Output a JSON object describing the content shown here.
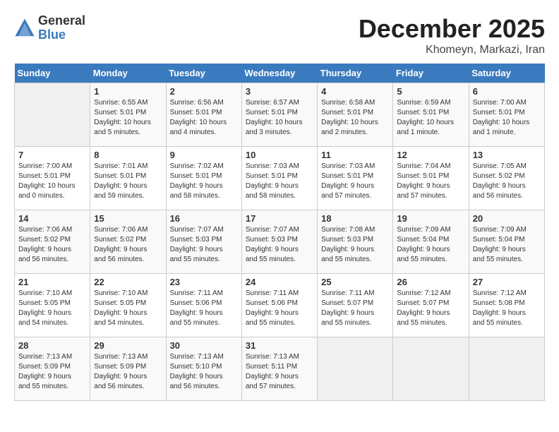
{
  "logo": {
    "general": "General",
    "blue": "Blue"
  },
  "title": "December 2025",
  "subtitle": "Khomeyn, Markazi, Iran",
  "weekdays": [
    "Sunday",
    "Monday",
    "Tuesday",
    "Wednesday",
    "Thursday",
    "Friday",
    "Saturday"
  ],
  "weeks": [
    [
      {
        "day": "",
        "info": ""
      },
      {
        "day": "1",
        "info": "Sunrise: 6:55 AM\nSunset: 5:01 PM\nDaylight: 10 hours\nand 5 minutes."
      },
      {
        "day": "2",
        "info": "Sunrise: 6:56 AM\nSunset: 5:01 PM\nDaylight: 10 hours\nand 4 minutes."
      },
      {
        "day": "3",
        "info": "Sunrise: 6:57 AM\nSunset: 5:01 PM\nDaylight: 10 hours\nand 3 minutes."
      },
      {
        "day": "4",
        "info": "Sunrise: 6:58 AM\nSunset: 5:01 PM\nDaylight: 10 hours\nand 2 minutes."
      },
      {
        "day": "5",
        "info": "Sunrise: 6:59 AM\nSunset: 5:01 PM\nDaylight: 10 hours\nand 1 minute."
      },
      {
        "day": "6",
        "info": "Sunrise: 7:00 AM\nSunset: 5:01 PM\nDaylight: 10 hours\nand 1 minute."
      }
    ],
    [
      {
        "day": "7",
        "info": "Sunrise: 7:00 AM\nSunset: 5:01 PM\nDaylight: 10 hours\nand 0 minutes."
      },
      {
        "day": "8",
        "info": "Sunrise: 7:01 AM\nSunset: 5:01 PM\nDaylight: 9 hours\nand 59 minutes."
      },
      {
        "day": "9",
        "info": "Sunrise: 7:02 AM\nSunset: 5:01 PM\nDaylight: 9 hours\nand 58 minutes."
      },
      {
        "day": "10",
        "info": "Sunrise: 7:03 AM\nSunset: 5:01 PM\nDaylight: 9 hours\nand 58 minutes."
      },
      {
        "day": "11",
        "info": "Sunrise: 7:03 AM\nSunset: 5:01 PM\nDaylight: 9 hours\nand 57 minutes."
      },
      {
        "day": "12",
        "info": "Sunrise: 7:04 AM\nSunset: 5:01 PM\nDaylight: 9 hours\nand 57 minutes."
      },
      {
        "day": "13",
        "info": "Sunrise: 7:05 AM\nSunset: 5:02 PM\nDaylight: 9 hours\nand 56 minutes."
      }
    ],
    [
      {
        "day": "14",
        "info": "Sunrise: 7:06 AM\nSunset: 5:02 PM\nDaylight: 9 hours\nand 56 minutes."
      },
      {
        "day": "15",
        "info": "Sunrise: 7:06 AM\nSunset: 5:02 PM\nDaylight: 9 hours\nand 56 minutes."
      },
      {
        "day": "16",
        "info": "Sunrise: 7:07 AM\nSunset: 5:03 PM\nDaylight: 9 hours\nand 55 minutes."
      },
      {
        "day": "17",
        "info": "Sunrise: 7:07 AM\nSunset: 5:03 PM\nDaylight: 9 hours\nand 55 minutes."
      },
      {
        "day": "18",
        "info": "Sunrise: 7:08 AM\nSunset: 5:03 PM\nDaylight: 9 hours\nand 55 minutes."
      },
      {
        "day": "19",
        "info": "Sunrise: 7:09 AM\nSunset: 5:04 PM\nDaylight: 9 hours\nand 55 minutes."
      },
      {
        "day": "20",
        "info": "Sunrise: 7:09 AM\nSunset: 5:04 PM\nDaylight: 9 hours\nand 55 minutes."
      }
    ],
    [
      {
        "day": "21",
        "info": "Sunrise: 7:10 AM\nSunset: 5:05 PM\nDaylight: 9 hours\nand 54 minutes."
      },
      {
        "day": "22",
        "info": "Sunrise: 7:10 AM\nSunset: 5:05 PM\nDaylight: 9 hours\nand 54 minutes."
      },
      {
        "day": "23",
        "info": "Sunrise: 7:11 AM\nSunset: 5:06 PM\nDaylight: 9 hours\nand 55 minutes."
      },
      {
        "day": "24",
        "info": "Sunrise: 7:11 AM\nSunset: 5:06 PM\nDaylight: 9 hours\nand 55 minutes."
      },
      {
        "day": "25",
        "info": "Sunrise: 7:11 AM\nSunset: 5:07 PM\nDaylight: 9 hours\nand 55 minutes."
      },
      {
        "day": "26",
        "info": "Sunrise: 7:12 AM\nSunset: 5:07 PM\nDaylight: 9 hours\nand 55 minutes."
      },
      {
        "day": "27",
        "info": "Sunrise: 7:12 AM\nSunset: 5:08 PM\nDaylight: 9 hours\nand 55 minutes."
      }
    ],
    [
      {
        "day": "28",
        "info": "Sunrise: 7:13 AM\nSunset: 5:09 PM\nDaylight: 9 hours\nand 55 minutes."
      },
      {
        "day": "29",
        "info": "Sunrise: 7:13 AM\nSunset: 5:09 PM\nDaylight: 9 hours\nand 56 minutes."
      },
      {
        "day": "30",
        "info": "Sunrise: 7:13 AM\nSunset: 5:10 PM\nDaylight: 9 hours\nand 56 minutes."
      },
      {
        "day": "31",
        "info": "Sunrise: 7:13 AM\nSunset: 5:11 PM\nDaylight: 9 hours\nand 57 minutes."
      },
      {
        "day": "",
        "info": ""
      },
      {
        "day": "",
        "info": ""
      },
      {
        "day": "",
        "info": ""
      }
    ]
  ]
}
